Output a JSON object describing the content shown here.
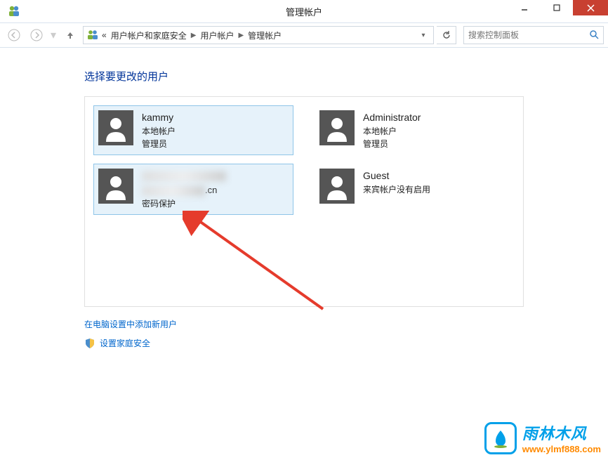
{
  "window": {
    "title": "管理帐户",
    "min_tip": "最小化",
    "max_tip": "最大化",
    "close_tip": "关闭"
  },
  "nav": {
    "back_tip": "后退",
    "forward_tip": "前进",
    "up_tip": "上一级",
    "breadcrumb_prefix": "«",
    "breadcrumb": [
      "用户帐户和家庭安全",
      "用户帐户",
      "管理帐户"
    ],
    "search_placeholder": "搜索控制面板"
  },
  "main": {
    "heading": "选择要更改的用户",
    "accounts": [
      {
        "name": "kammy",
        "line2": "本地帐户",
        "line3": "管理员",
        "selected": true,
        "blurred": false
      },
      {
        "name": "Administrator",
        "line2": "本地帐户",
        "line3": "管理员",
        "selected": false,
        "blurred": false
      },
      {
        "name_suffix": ".cn",
        "line2": "密码保护",
        "line3": "",
        "selected": true,
        "blurred": true
      },
      {
        "name": "Guest",
        "line2": "来宾帐户没有启用",
        "line3": "",
        "selected": false,
        "blurred": false
      }
    ],
    "links": {
      "add_user": "在电脑设置中添加新用户",
      "family_safety": "设置家庭安全"
    }
  },
  "watermark": {
    "cn": "雨林木风",
    "url": "www.ylmf888.com"
  }
}
